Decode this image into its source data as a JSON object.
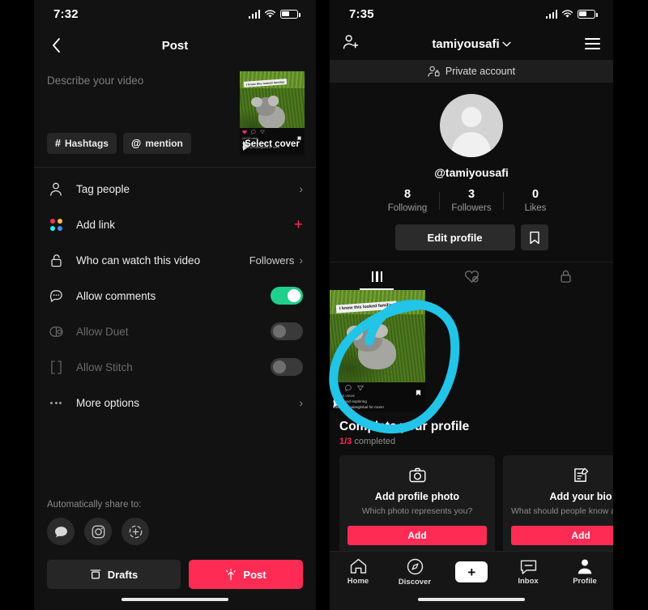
{
  "left_phone": {
    "status_bar": {
      "time": "7:32",
      "signal": "signal-bars",
      "wifi": "wifi-icon",
      "battery": "battery-icon"
    },
    "header": {
      "back": "chevron-left-icon",
      "title": "Post"
    },
    "compose": {
      "placeholder": "Describe your video",
      "value": "",
      "chips": [
        {
          "glyph": "#",
          "label": "Hashtags"
        },
        {
          "glyph": "@",
          "label": "mention"
        }
      ]
    },
    "cover": {
      "caption_sticker": "I knew this looked familiar",
      "select_cover_label": "Select cover",
      "overlay_count": "19,715 views",
      "overlay_caption_line1": "nature and exploring",
      "overlay_caption_line2": "follow @koalasglobal for more!"
    },
    "options": [
      {
        "icon": "person-icon",
        "label": "Tag people",
        "control": "chevron",
        "value": "",
        "dim": false
      },
      {
        "icon": "link-dots-icon",
        "label": "Add link",
        "control": "plus",
        "value": "",
        "dim": false
      },
      {
        "icon": "lock-open-icon",
        "label": "Who can watch this video",
        "control": "chevron",
        "value": "Followers",
        "dim": false
      },
      {
        "icon": "comment-icon",
        "label": "Allow comments",
        "control": "toggle-on",
        "value": "",
        "dim": false
      },
      {
        "icon": "duet-icon",
        "label": "Allow Duet",
        "control": "toggle-off",
        "value": "",
        "dim": true
      },
      {
        "icon": "stitch-icon",
        "label": "Allow Stitch",
        "control": "toggle-off",
        "value": "",
        "dim": true
      },
      {
        "icon": "ellipsis-icon",
        "label": "More options",
        "control": "chevron",
        "value": "",
        "dim": false
      }
    ],
    "share": {
      "label": "Automatically share to:",
      "targets": [
        {
          "icon": "message-bubble-icon",
          "name": "messages"
        },
        {
          "icon": "instagram-icon",
          "name": "instagram"
        },
        {
          "icon": "instagram-story-icon",
          "name": "instagram-story"
        }
      ]
    },
    "actions": {
      "drafts_label": "Drafts",
      "drafts_icon": "drafts-icon",
      "post_label": "Post",
      "post_icon": "post-sparkle-icon",
      "post_color": "#fe2c55"
    }
  },
  "right_phone": {
    "status_bar": {
      "time": "7:35",
      "signal": "signal-bars",
      "wifi": "wifi-icon",
      "battery": "battery-icon"
    },
    "header": {
      "add_friend_icon": "add-person-icon",
      "username": "tamiyousafi",
      "chevron": "chevron-down-icon",
      "menu_icon": "hamburger-icon"
    },
    "private_banner": {
      "icon": "private-person-icon",
      "label": "Private account"
    },
    "profile": {
      "avatar": "default-avatar",
      "handle": "@tamiyousafi",
      "stats": [
        {
          "value": "8",
          "label": "Following"
        },
        {
          "value": "3",
          "label": "Followers"
        },
        {
          "value": "0",
          "label": "Likes"
        }
      ],
      "edit_profile_label": "Edit profile",
      "bookmark_icon": "bookmark-icon"
    },
    "tabs": [
      {
        "icon": "grid-icon",
        "name": "videos",
        "active": true
      },
      {
        "icon": "heart-slash-icon",
        "name": "liked",
        "active": false
      },
      {
        "icon": "lock-icon",
        "name": "private",
        "active": false
      }
    ],
    "video_grid": [
      {
        "sticker": "I knew this looked familiar",
        "views": "19,715 views",
        "caption_line1": "nature and exploring",
        "caption_line2": "follow @koalasglobal for more!",
        "play_icon": "play-icon"
      }
    ],
    "complete_profile": {
      "title": "Complete your profile",
      "progress_done": "1/3",
      "progress_label": "completed",
      "accent": "#fe2c55",
      "cards": [
        {
          "icon": "camera-icon",
          "title": "Add profile photo",
          "desc": "Which photo represents you?",
          "button": "Add"
        },
        {
          "icon": "edit-note-icon",
          "title": "Add your bio",
          "desc": "What should people know about you?",
          "button": "Add"
        }
      ]
    },
    "bottom_nav": [
      {
        "icon": "home-icon",
        "label": "Home",
        "active": false
      },
      {
        "icon": "compass-icon",
        "label": "Discover",
        "active": false
      },
      {
        "icon": "plus-icon",
        "label": "",
        "active": false
      },
      {
        "icon": "inbox-icon",
        "label": "Inbox",
        "active": false
      },
      {
        "icon": "profile-icon",
        "label": "Profile",
        "active": true
      }
    ]
  },
  "annotation": {
    "shape": "circle-loop",
    "color": "#22c4e8",
    "target": "first-video-thumbnail"
  }
}
